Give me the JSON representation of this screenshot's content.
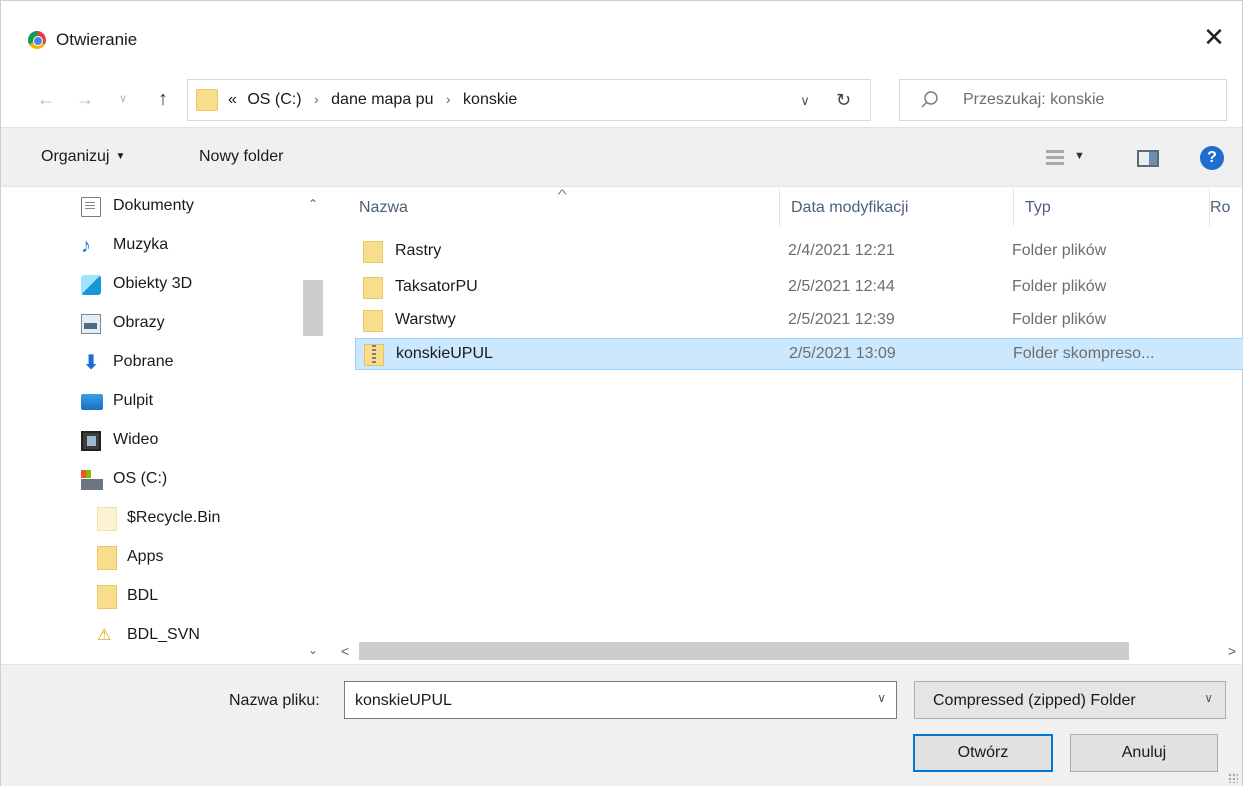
{
  "window": {
    "title": "Otwieranie",
    "close_label": "✕"
  },
  "navigation": {
    "back_icon": "←",
    "forward_icon": "→",
    "recent_icon": "∨",
    "up_icon": "↑",
    "breadcrumb": {
      "overflow": "«",
      "items": [
        "OS (C:)",
        "dane mapa pu",
        "konskie"
      ],
      "separator": "›"
    },
    "dropdown_icon": "∨",
    "refresh_icon": "↻",
    "search": {
      "placeholder": "Przeszukaj: konskie"
    }
  },
  "toolbar": {
    "organize_label": "Organizuj",
    "organize_caret": "▼",
    "new_folder_label": "Nowy folder",
    "view_caret": "▼",
    "help_label": "?"
  },
  "sidebar": {
    "scroll_up": "⌃",
    "scroll_down": "⌄",
    "items": [
      {
        "label": "Dokumenty",
        "icon": "documents-icon"
      },
      {
        "label": "Muzyka",
        "icon": "music-icon"
      },
      {
        "label": "Obiekty 3D",
        "icon": "3d-objects-icon"
      },
      {
        "label": "Obrazy",
        "icon": "pictures-icon"
      },
      {
        "label": "Pobrane",
        "icon": "downloads-icon"
      },
      {
        "label": "Pulpit",
        "icon": "desktop-icon"
      },
      {
        "label": "Wideo",
        "icon": "videos-icon"
      },
      {
        "label": "OS (C:)",
        "icon": "drive-icon"
      },
      {
        "label": "$Recycle.Bin",
        "icon": "folder-icon"
      },
      {
        "label": "Apps",
        "icon": "folder-icon"
      },
      {
        "label": "BDL",
        "icon": "folder-icon"
      },
      {
        "label": "BDL_SVN",
        "icon": "svn-folder-icon"
      }
    ]
  },
  "filelist": {
    "sort_arrow": "^",
    "columns": [
      "Nazwa",
      "Data modyfikacji",
      "Typ",
      "Ro"
    ],
    "rows": [
      {
        "name": "Rastry",
        "date": "2/4/2021 12:21",
        "type": "Folder plików",
        "icon": "folder-icon",
        "selected": false
      },
      {
        "name": "TaksatorPU",
        "date": "2/5/2021 12:44",
        "type": "Folder plików",
        "icon": "folder-icon",
        "selected": false
      },
      {
        "name": "Warstwy",
        "date": "2/5/2021 12:39",
        "type": "Folder plików",
        "icon": "folder-icon",
        "selected": false
      },
      {
        "name": "konskieUPUL",
        "date": "2/5/2021 13:09",
        "type": "Folder skompreso...",
        "icon": "zip-folder-icon",
        "selected": true
      }
    ],
    "hscroll_left": "<",
    "hscroll_right": ">"
  },
  "bottom": {
    "filename_label": "Nazwa pliku:",
    "filename_value": "konskieUPUL",
    "filename_dropdown": "∨",
    "filetype_value": "Compressed (zipped) Folder",
    "filetype_dropdown": "∨",
    "open_label": "Otwórz",
    "cancel_label": "Anuluj"
  },
  "colors": {
    "selection_bg": "#cce8ff",
    "selection_border": "#99d1ff",
    "accent": "#0078d7",
    "folder": "#f8dd8a"
  }
}
